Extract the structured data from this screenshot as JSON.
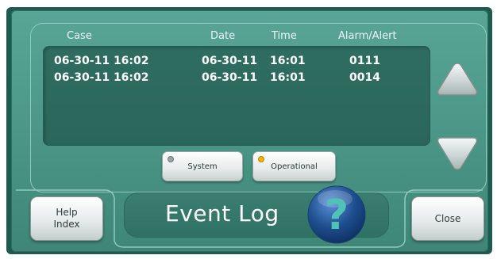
{
  "table": {
    "headers": {
      "case": "Case",
      "date": "Date",
      "time": "Time",
      "alarm": "Alarm/Alert"
    },
    "rows": [
      {
        "case": "06-30-11 16:02",
        "date": "06-30-11",
        "time": "16:01",
        "alarm": "0111"
      },
      {
        "case": "06-30-11 16:02",
        "date": "06-30-11",
        "time": "16:01",
        "alarm": "0014"
      }
    ]
  },
  "filters": {
    "system": {
      "label": "System",
      "indicator_color": "#9aa2a2"
    },
    "operational": {
      "label": "Operational",
      "indicator_color": "#f2b400"
    }
  },
  "footer": {
    "help_line1": "Help",
    "help_line2": "Index",
    "title": "Event Log",
    "help_glyph": "?",
    "close": "Close"
  },
  "icons": {
    "scroll_up": "triangle-up-icon",
    "scroll_down": "triangle-down-icon",
    "help": "question-mark-icon"
  },
  "colors": {
    "panel": "#4a9586",
    "screen": "#2f6d61",
    "help_orb": "#1f4f8f"
  }
}
